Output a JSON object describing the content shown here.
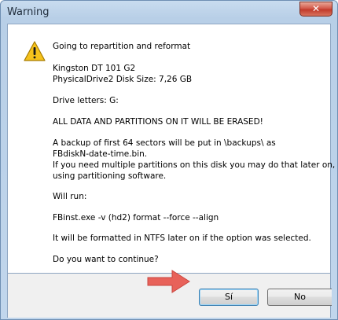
{
  "window": {
    "title": "Warning"
  },
  "dialog": {
    "lines": [
      "Going to repartition and reformat",
      "Kingston DT 101 G2",
      "PhysicalDrive2   Disk Size: 7,26 GB",
      "Drive letters:  G:",
      "ALL DATA AND PARTITIONS ON IT WILL BE ERASED!",
      "A backup of first 64 sectors will be put in \\backups\\ as",
      "FBdiskN-date-time.bin.",
      "If you need multiple partitions on this disk you may do that later on,",
      "using partitioning software.",
      "Will run:",
      "FBinst.exe -v (hd2) format --force   --align",
      "It will be formatted in NTFS later on if the option was selected.",
      "Do you want to continue?"
    ]
  },
  "buttons": {
    "yes_label": "Sí",
    "no_label": "No"
  },
  "colors": {
    "accent": "#3c7fb1",
    "close": "#c23b2b",
    "arrow": "#e8625a"
  },
  "icons": {
    "warning": "warning-icon",
    "close": "close-icon",
    "arrow": "pointer-arrow"
  }
}
